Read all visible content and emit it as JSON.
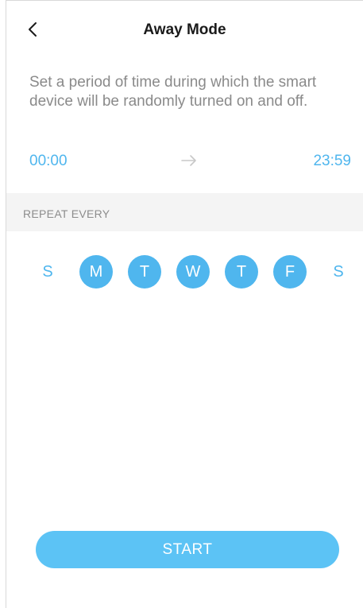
{
  "header": {
    "title": "Away Mode",
    "back_icon": "chevron-left-icon"
  },
  "description": "Set a period of time during which the smart device will be randomly turned on and off.",
  "schedule": {
    "start_time": "00:00",
    "end_time": "23:59",
    "arrow_icon": "arrow-right-icon"
  },
  "repeat": {
    "section_label": "REPEAT EVERY",
    "days": [
      {
        "label": "S",
        "selected": false
      },
      {
        "label": "M",
        "selected": true
      },
      {
        "label": "T",
        "selected": true
      },
      {
        "label": "W",
        "selected": true
      },
      {
        "label": "T",
        "selected": true
      },
      {
        "label": "F",
        "selected": true
      },
      {
        "label": "S",
        "selected": false
      }
    ]
  },
  "actions": {
    "start_label": "START"
  },
  "colors": {
    "accent": "#4fb6ee",
    "button": "#5cc3f5",
    "muted_text": "#8a8a8a",
    "section_bg": "#f4f4f4"
  }
}
